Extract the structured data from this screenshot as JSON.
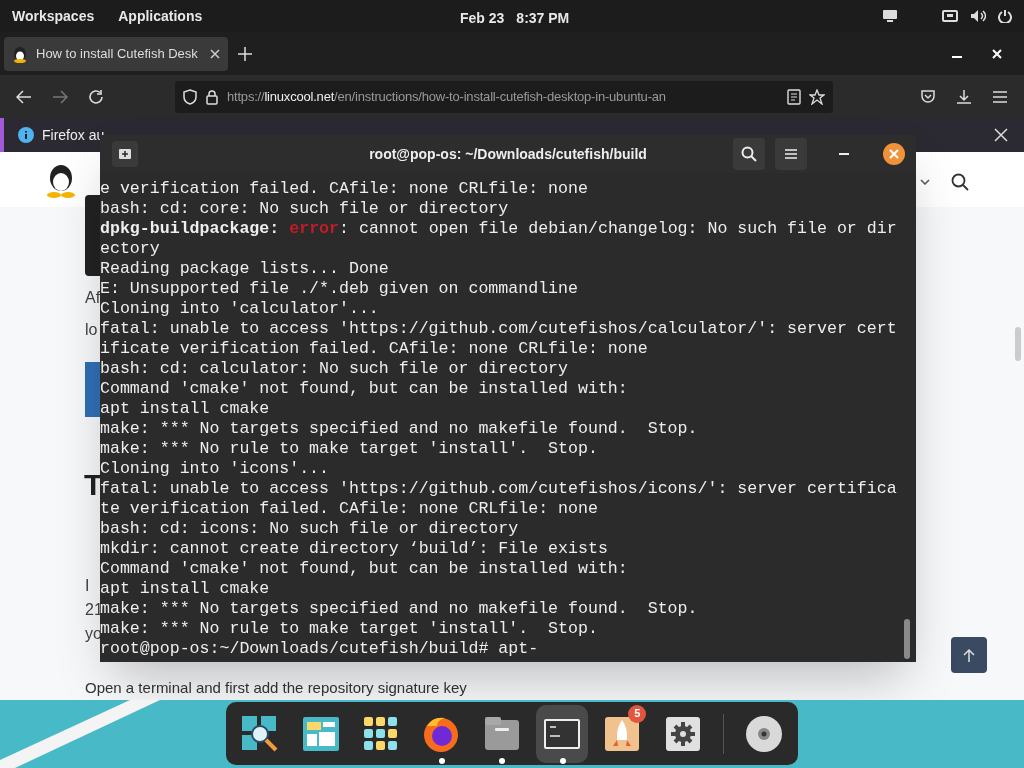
{
  "top_bar": {
    "left": [
      "Workspaces",
      "Applications"
    ],
    "date": "Feb 23",
    "time": "8:37 PM"
  },
  "browser": {
    "tab": {
      "title": "How to install Cutefish Desk",
      "selected": true
    },
    "url": {
      "scheme": "https://",
      "host": "linuxcool.net",
      "path": "/en/instructions/how-to-install-cutefish-desktop-in-ubuntu-an"
    },
    "notification": "Firefox au",
    "page": {
      "para_fragments": [
        "Af",
        "lo"
      ],
      "section_fragments": [
        "T"
      ],
      "body_fragments": [
        "I",
        "21",
        "yo"
      ],
      "bottom_text": "Open a terminal and first add the repository signature key"
    }
  },
  "terminal": {
    "title": "root@pop-os: ~/Downloads/cutefish/build",
    "lines": [
      {
        "text": "e verification failed. CAfile: none CRLfile: none"
      },
      {
        "text": "bash: cd: core: No such file or directory"
      },
      {
        "text": "**dpkg-buildpackage:** ",
        "error": "error",
        "rest": ": cannot open file debian/changelog: No such file or dir"
      },
      {
        "text": "ectory"
      },
      {
        "text": "Reading package lists... Done"
      },
      {
        "text": "E: Unsupported file ./*.deb given on commandline"
      },
      {
        "text": "Cloning into 'calculator'..."
      },
      {
        "text": "fatal: unable to access 'https://github.com/cutefishos/calculator/': server cert"
      },
      {
        "text": "ificate verification failed. CAfile: none CRLfile: none"
      },
      {
        "text": "bash: cd: calculator: No such file or directory"
      },
      {
        "text": "Command 'cmake' not found, but can be installed with:"
      },
      {
        "text": "apt install cmake"
      },
      {
        "text": "make: *** No targets specified and no makefile found.  Stop."
      },
      {
        "text": "make: *** No rule to make target 'install'.  Stop."
      },
      {
        "text": "Cloning into 'icons'..."
      },
      {
        "text": "fatal: unable to access 'https://github.com/cutefishos/icons/': server certifica"
      },
      {
        "text": "te verification failed. CAfile: none CRLfile: none"
      },
      {
        "text": "bash: cd: icons: No such file or directory"
      },
      {
        "text": "mkdir: cannot create directory ‘build’: File exists"
      },
      {
        "text": "Command 'cmake' not found, but can be installed with:"
      },
      {
        "text": "apt install cmake"
      },
      {
        "text": "make: *** No targets specified and no makefile found.  Stop."
      },
      {
        "text": "make: *** No rule to make target 'install'.  Stop."
      },
      {
        "text": "root@pop-os:~/Downloads/cutefish/build# apt-"
      }
    ]
  },
  "dock": [
    {
      "kind": "search",
      "running": false,
      "selected": false
    },
    {
      "kind": "windows",
      "running": false,
      "selected": false
    },
    {
      "kind": "apps",
      "running": false,
      "selected": false
    },
    {
      "kind": "firefox",
      "running": true,
      "selected": false
    },
    {
      "kind": "files",
      "running": true,
      "selected": false
    },
    {
      "kind": "terminal",
      "running": true,
      "selected": true
    },
    {
      "kind": "rocket",
      "running": false,
      "selected": false,
      "badge": "5"
    },
    {
      "kind": "settings",
      "running": false,
      "selected": false
    },
    {
      "kind": "separator"
    },
    {
      "kind": "disc",
      "running": false,
      "selected": false
    }
  ]
}
